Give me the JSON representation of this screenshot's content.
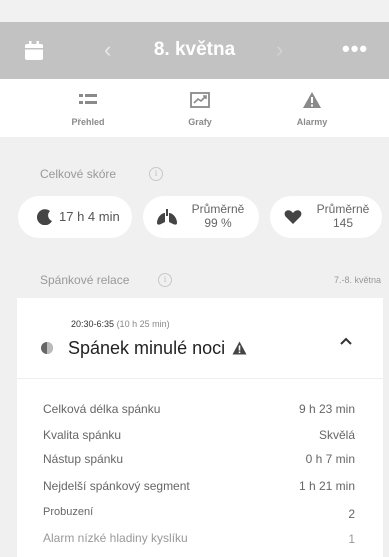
{
  "header": {
    "title": "8. května",
    "prev_symbol": "‹",
    "next_symbol": "›",
    "more_symbol": "•••"
  },
  "tabs": [
    {
      "label": "Přehled",
      "icon": "list-icon"
    },
    {
      "label": "Grafy",
      "icon": "chart-icon"
    },
    {
      "label": "Alarmy",
      "icon": "warning-icon"
    }
  ],
  "overall": {
    "label": "Celkové skóre",
    "duration": "17 h 4 min",
    "lungs_label": "Průměrně",
    "lungs_value": "99 %",
    "heart_label": "Průměrně",
    "heart_value": "145"
  },
  "sessions": {
    "label": "Spánkové relace",
    "date_range": "7.-8. května"
  },
  "session": {
    "time_range": "20:30-6:35",
    "duration_note": "(10 h 25 min)",
    "title": "Spánek minulé noci",
    "rows": [
      {
        "label": "Celková délka spánku",
        "value": "9 h 23 min"
      },
      {
        "label": "Kvalita spánku",
        "value": "Skvělá"
      },
      {
        "label": "Nástup spánku",
        "value": "0 h 7 min"
      },
      {
        "label": "Nejdelší spánkový segment",
        "value": "1 h 21 min"
      },
      {
        "label": "Probuzení",
        "value": "2"
      },
      {
        "label": "Alarm nízké hladiny kyslíku",
        "value": "1"
      }
    ]
  },
  "colors": {
    "header_bg": "#c2c2c2",
    "page_bg": "#f0f0f0"
  }
}
